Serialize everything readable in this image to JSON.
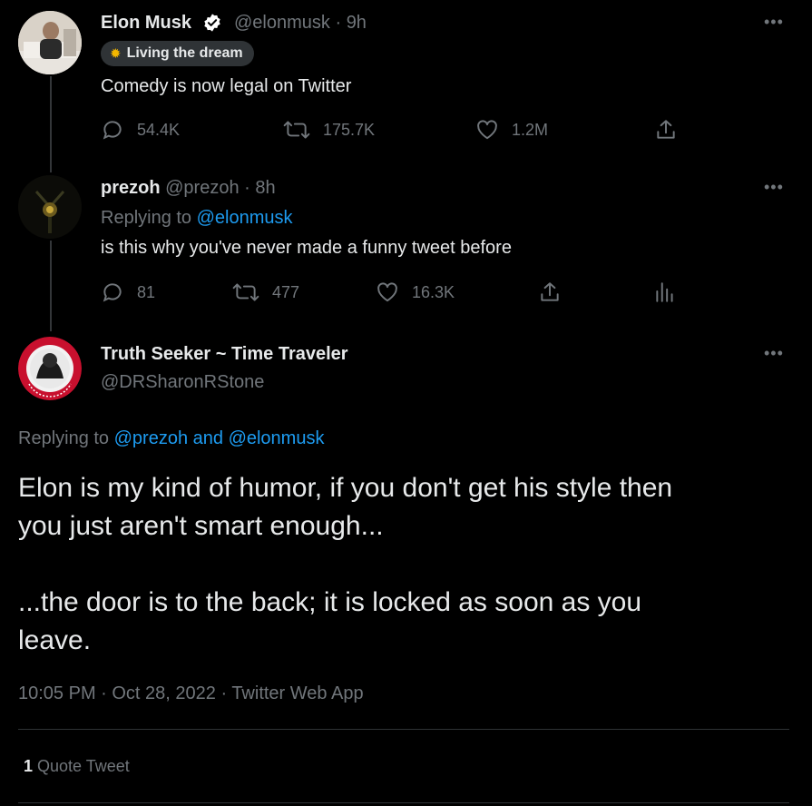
{
  "tweet1": {
    "name": "Elon Musk",
    "handle": "@elonmusk",
    "time": "9h",
    "badge_label": "Living the dream",
    "text": "Comedy is now legal on Twitter",
    "replies": "54.4K",
    "retweets": "175.7K",
    "likes": "1.2M"
  },
  "tweet2": {
    "name": "prezoh",
    "handle": "@prezoh",
    "time": "8h",
    "replying_prefix": "Replying to",
    "replying_to": "@elonmusk",
    "text": "is this why you've never made a funny tweet before",
    "replies": "81",
    "retweets": "477",
    "likes": "16.3K"
  },
  "main": {
    "name": "Truth Seeker ~ Time Traveler",
    "handle": "@DRSharonRStone",
    "replying_prefix": "Replying to",
    "replying_to": "@prezoh and @elonmusk",
    "text_line1": "Elon is my kind of humor, if you don't get his style then",
    "text_line2": "you just aren't smart enough...",
    "text_line3": "...the door is to the back; it is locked as soon as you",
    "text_line4": "leave.",
    "timestamp": "10:05 PM · Oct 28, 2022 · Twitter Web App",
    "quote_count": "1",
    "quote_label": "Quote Tweet"
  },
  "colors": {
    "link": "#1d9bf0",
    "muted": "#71767b",
    "verified": "#ffffff",
    "background": "#000000"
  },
  "icons": [
    "verified-badge-icon",
    "sun-emoji-icon",
    "reply-icon",
    "retweet-icon",
    "like-icon",
    "share-icon",
    "analytics-icon",
    "more-icon"
  ]
}
